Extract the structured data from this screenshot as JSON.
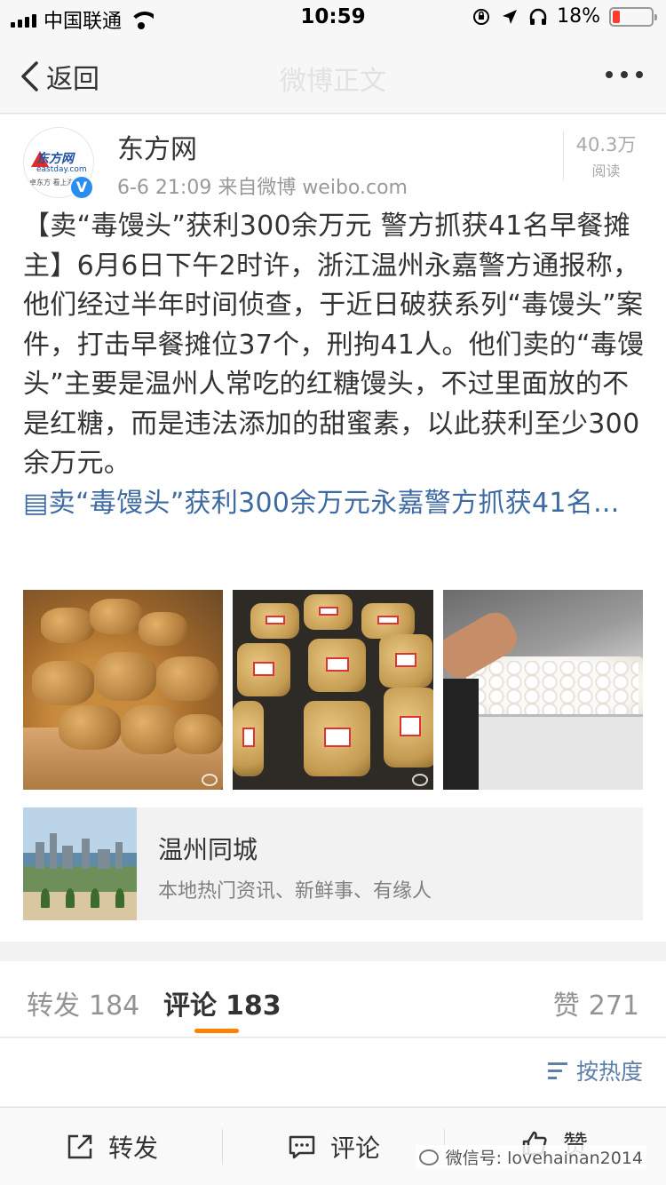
{
  "status_bar": {
    "carrier": "中国联通",
    "time": "10:59",
    "battery_text": "18%",
    "battery_level": 0.18
  },
  "nav": {
    "back_label": "返回",
    "title": "微博正文"
  },
  "post": {
    "author": "东方网",
    "avatar_logo_text": "东方网",
    "avatar_logo_sub": "eastday.com",
    "avatar_logo_tag": "卓东方 看上海 看…",
    "meta": "6-6 21:09  来自微博 weibo.com",
    "reads_num": "40.3万",
    "reads_label": "阅读",
    "text": "【卖“毒馒头”获利300余万元 警方抓获41名早餐摊主】6月6日下午2时许，浙江温州永嘉警方通报称，他们经过半年时间侦查，于近日破获系列“毒馒头”案件，打击早餐摊位37个，刑拘41人。他们卖的“毒馒头”主要是温州人常吃的红糖馒头，不过里面放的不是红糖，而是违法添加的甜蜜素，以此获利至少300余万元。",
    "link_text": "卖“毒馒头”获利300余万元永嘉警方抓获41名..."
  },
  "link_card": {
    "title": "温州同城",
    "subtitle": "本地热门资讯、新鲜事、有缘人"
  },
  "tabs": [
    {
      "label": "转发",
      "count": "184"
    },
    {
      "label": "评论",
      "count": "183"
    },
    {
      "label": "赞",
      "count": "271"
    }
  ],
  "sort_label": "按热度",
  "toolbar": {
    "repost_label": "转发",
    "comment_label": "评论",
    "like_label": "赞"
  },
  "watermark": "微信号: lovehainan2014",
  "colors": {
    "accent_orange": "#ff8200",
    "link_blue": "#3d6aa3",
    "verified_blue": "#2a8ef0",
    "battery_red": "#ff3b30"
  }
}
